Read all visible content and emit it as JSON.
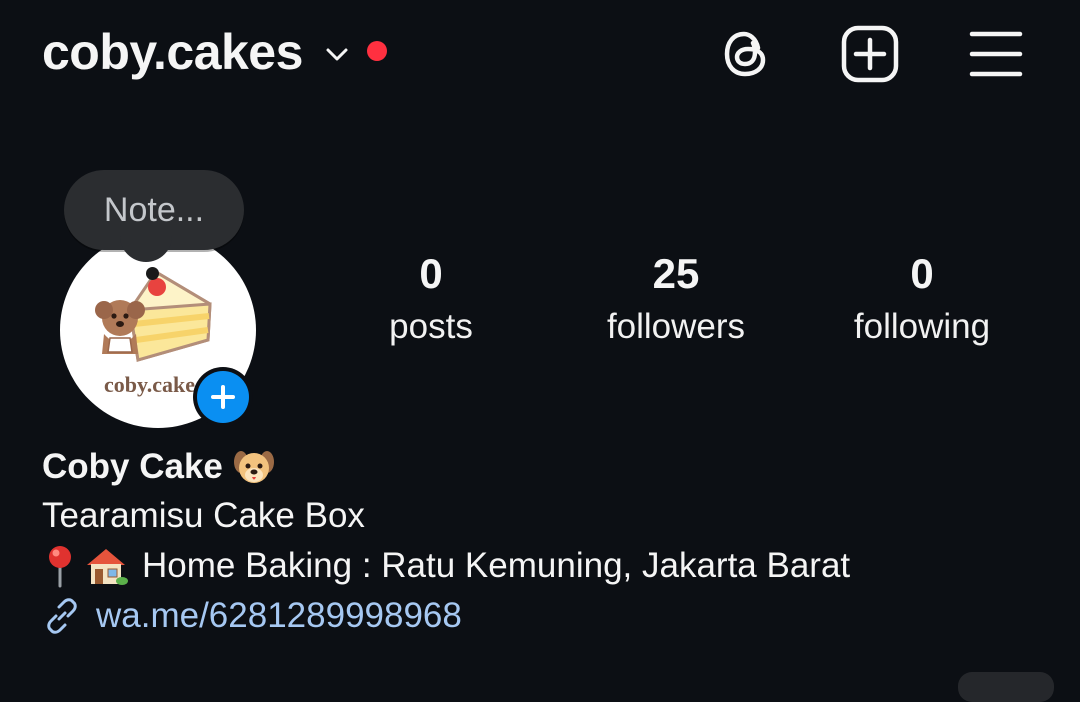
{
  "header": {
    "username": "coby.cakes",
    "icons": {
      "account_switch": "chevron-down-icon",
      "notification": "notification-dot",
      "threads": "threads-icon",
      "create": "plus-square-icon",
      "menu": "hamburger-menu-icon"
    },
    "colors": {
      "notification_dot": "#ff3040",
      "background": "#0c0f14"
    }
  },
  "note": {
    "placeholder": "Note..."
  },
  "avatar": {
    "logo_text": "coby.cake",
    "add_story_icon": "plus-icon",
    "add_story_color": "#0a8ff2"
  },
  "stats": [
    {
      "count": "0",
      "label": "posts"
    },
    {
      "count": "25",
      "label": "followers"
    },
    {
      "count": "0",
      "label": "following"
    }
  ],
  "bio": {
    "name": "Coby Cake",
    "name_emoji": "dog-face-emoji",
    "line1": "Tearamisu Cake Box",
    "location_icons": [
      "round-pushpin-emoji",
      "house-with-garden-emoji"
    ],
    "location_text": "Home Baking : Ratu Kemuning, Jakarta Barat",
    "link_icon": "link-icon",
    "link": "wa.me/6281289998968",
    "link_color": "#a6c8f2"
  }
}
